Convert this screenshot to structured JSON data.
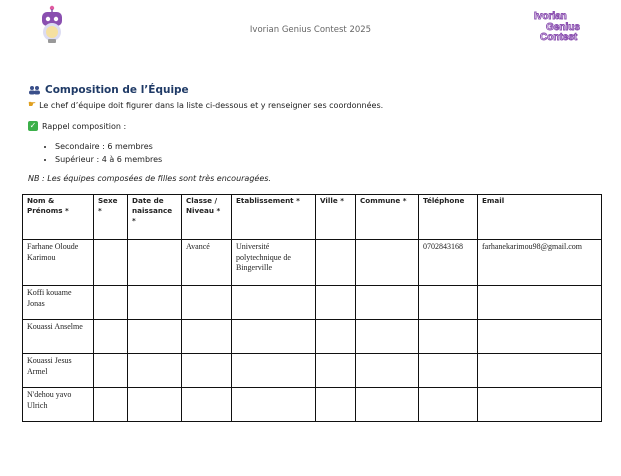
{
  "header": {
    "title": "Ivorian Genius Contest 2025",
    "logo_left_icon": "robot-icon",
    "logo_right": "Ivorian Genius Contest"
  },
  "section": {
    "title": "Composition de l’Équipe",
    "intro": "Le chef d’équipe doit figurer dans la liste ci-dessous et y renseigner ses coordonnées.",
    "rappel": "Rappel composition :",
    "bullets": [
      "Secondaire : 6 membres",
      "Supérieur : 4 à 6 membres"
    ],
    "nb": "NB : Les équipes composées de filles sont très encouragées."
  },
  "table": {
    "headers": [
      "Nom & Prénoms *",
      "Sexe *",
      "Date de naissance *",
      "Classe / Niveau *",
      "Etablissement *",
      "Ville *",
      "Commune *",
      "Téléphone",
      "Email"
    ],
    "rows": [
      [
        "Farhane Oloude Karimou",
        "",
        "",
        "Avancé",
        "Université polytechnique de Bingerville",
        "",
        "",
        "0702843168",
        "farhanekarimou98@gmail.com"
      ],
      [
        "Koffi kouame Jonas",
        "",
        "",
        "",
        "",
        "",
        "",
        "",
        ""
      ],
      [
        "Kouassi Anselme",
        "",
        "",
        "",
        "",
        "",
        "",
        "",
        ""
      ],
      [
        "Kouassi Jesus Armel",
        "",
        "",
        "",
        "",
        "",
        "",
        "",
        ""
      ],
      [
        "N'dehou yavo Ulrich",
        "",
        "",
        "",
        "",
        "",
        "",
        "",
        ""
      ]
    ]
  },
  "colors": {
    "title": "#1f3a66",
    "logo_purple": "#8a4fb0",
    "check": "#3cb04a"
  }
}
